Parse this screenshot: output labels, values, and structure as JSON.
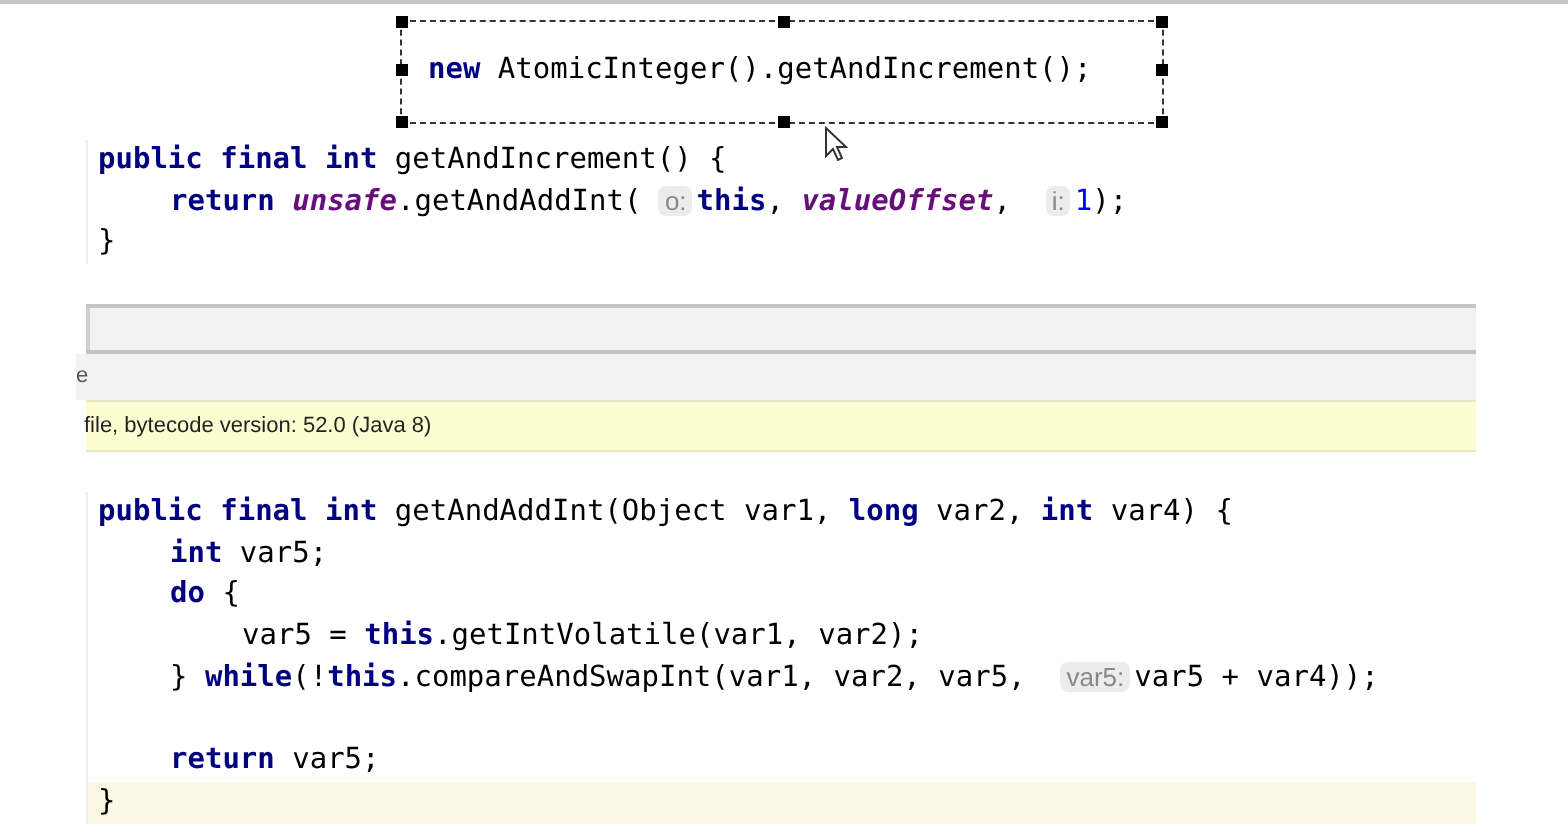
{
  "snippet": [
    {
      "kind": "kw",
      "text": "new"
    },
    {
      "kind": "plain",
      "text": " AtomicInteger().getAndIncrement();"
    }
  ],
  "block_1": {
    "lines": [
      {
        "kind": "code",
        "current": false,
        "tokens": [
          {
            "kind": "kw",
            "text": "public final int"
          },
          {
            "kind": "plain",
            "text": " getAndIncrement() {"
          }
        ],
        "children": [
          {
            "kind": "code",
            "current": false,
            "tokens": [
              {
                "kind": "kw",
                "text": "return"
              },
              {
                "kind": "field",
                "text": " unsafe"
              },
              {
                "kind": "plain",
                "text": ".getAndAddInt( "
              },
              {
                "kind": "hint",
                "text": "o:"
              },
              {
                "kind": "kw",
                "text": "this"
              },
              {
                "kind": "plain",
                "text": ", "
              },
              {
                "kind": "field",
                "text": "valueOffset"
              },
              {
                "kind": "plain",
                "text": ",  "
              },
              {
                "kind": "hint",
                "text": "i:"
              },
              {
                "kind": "num",
                "text": "1"
              },
              {
                "kind": "plain",
                "text": ");"
              }
            ]
          }
        ]
      },
      {
        "kind": "code",
        "current": false,
        "tokens": [
          {
            "kind": "plain",
            "text": "}"
          }
        ]
      }
    ]
  },
  "toolbar": {
    "tab_text": "e"
  },
  "notice": {
    "text": "file, bytecode version: 52.0 (Java 8)"
  },
  "block_2": {
    "lines": [
      {
        "kind": "code",
        "current": false,
        "tokens": [
          {
            "kind": "kw",
            "text": "public final int"
          },
          {
            "kind": "plain",
            "text": " getAndAddInt(Object var1, "
          },
          {
            "kind": "kw",
            "text": "long"
          },
          {
            "kind": "plain",
            "text": " var2, "
          },
          {
            "kind": "kw",
            "text": "int"
          },
          {
            "kind": "plain",
            "text": " var4) {"
          }
        ],
        "children": [
          {
            "kind": "code",
            "current": false,
            "tokens": [
              {
                "kind": "kw",
                "text": "int"
              },
              {
                "kind": "plain",
                "text": " var5;"
              }
            ]
          },
          {
            "kind": "code",
            "current": false,
            "tokens": [
              {
                "kind": "kw",
                "text": "do"
              },
              {
                "kind": "plain",
                "text": " {"
              }
            ],
            "children": [
              {
                "kind": "code",
                "current": false,
                "tokens": [
                  {
                    "kind": "plain",
                    "text": "var5 = "
                  },
                  {
                    "kind": "kw",
                    "text": "this"
                  },
                  {
                    "kind": "plain",
                    "text": ".getIntVolatile(var1, var2);"
                  }
                ]
              }
            ]
          },
          {
            "kind": "code",
            "current": false,
            "tokens": [
              {
                "kind": "plain",
                "text": "} "
              },
              {
                "kind": "kw",
                "text": "while"
              },
              {
                "kind": "plain",
                "text": "(!"
              },
              {
                "kind": "kw",
                "text": "this"
              },
              {
                "kind": "plain",
                "text": ".compareAndSwapInt(var1, var2, var5,  "
              },
              {
                "kind": "hint",
                "text": "var5:"
              },
              {
                "kind": "plain",
                "text": "var5 + var4));"
              }
            ]
          },
          {
            "kind": "blank"
          },
          {
            "kind": "code",
            "current": false,
            "tokens": [
              {
                "kind": "kw",
                "text": "return"
              },
              {
                "kind": "plain",
                "text": " var5;"
              }
            ]
          }
        ]
      },
      {
        "kind": "code",
        "current": true,
        "tokens": [
          {
            "kind": "plain",
            "text": "}"
          }
        ]
      }
    ]
  }
}
